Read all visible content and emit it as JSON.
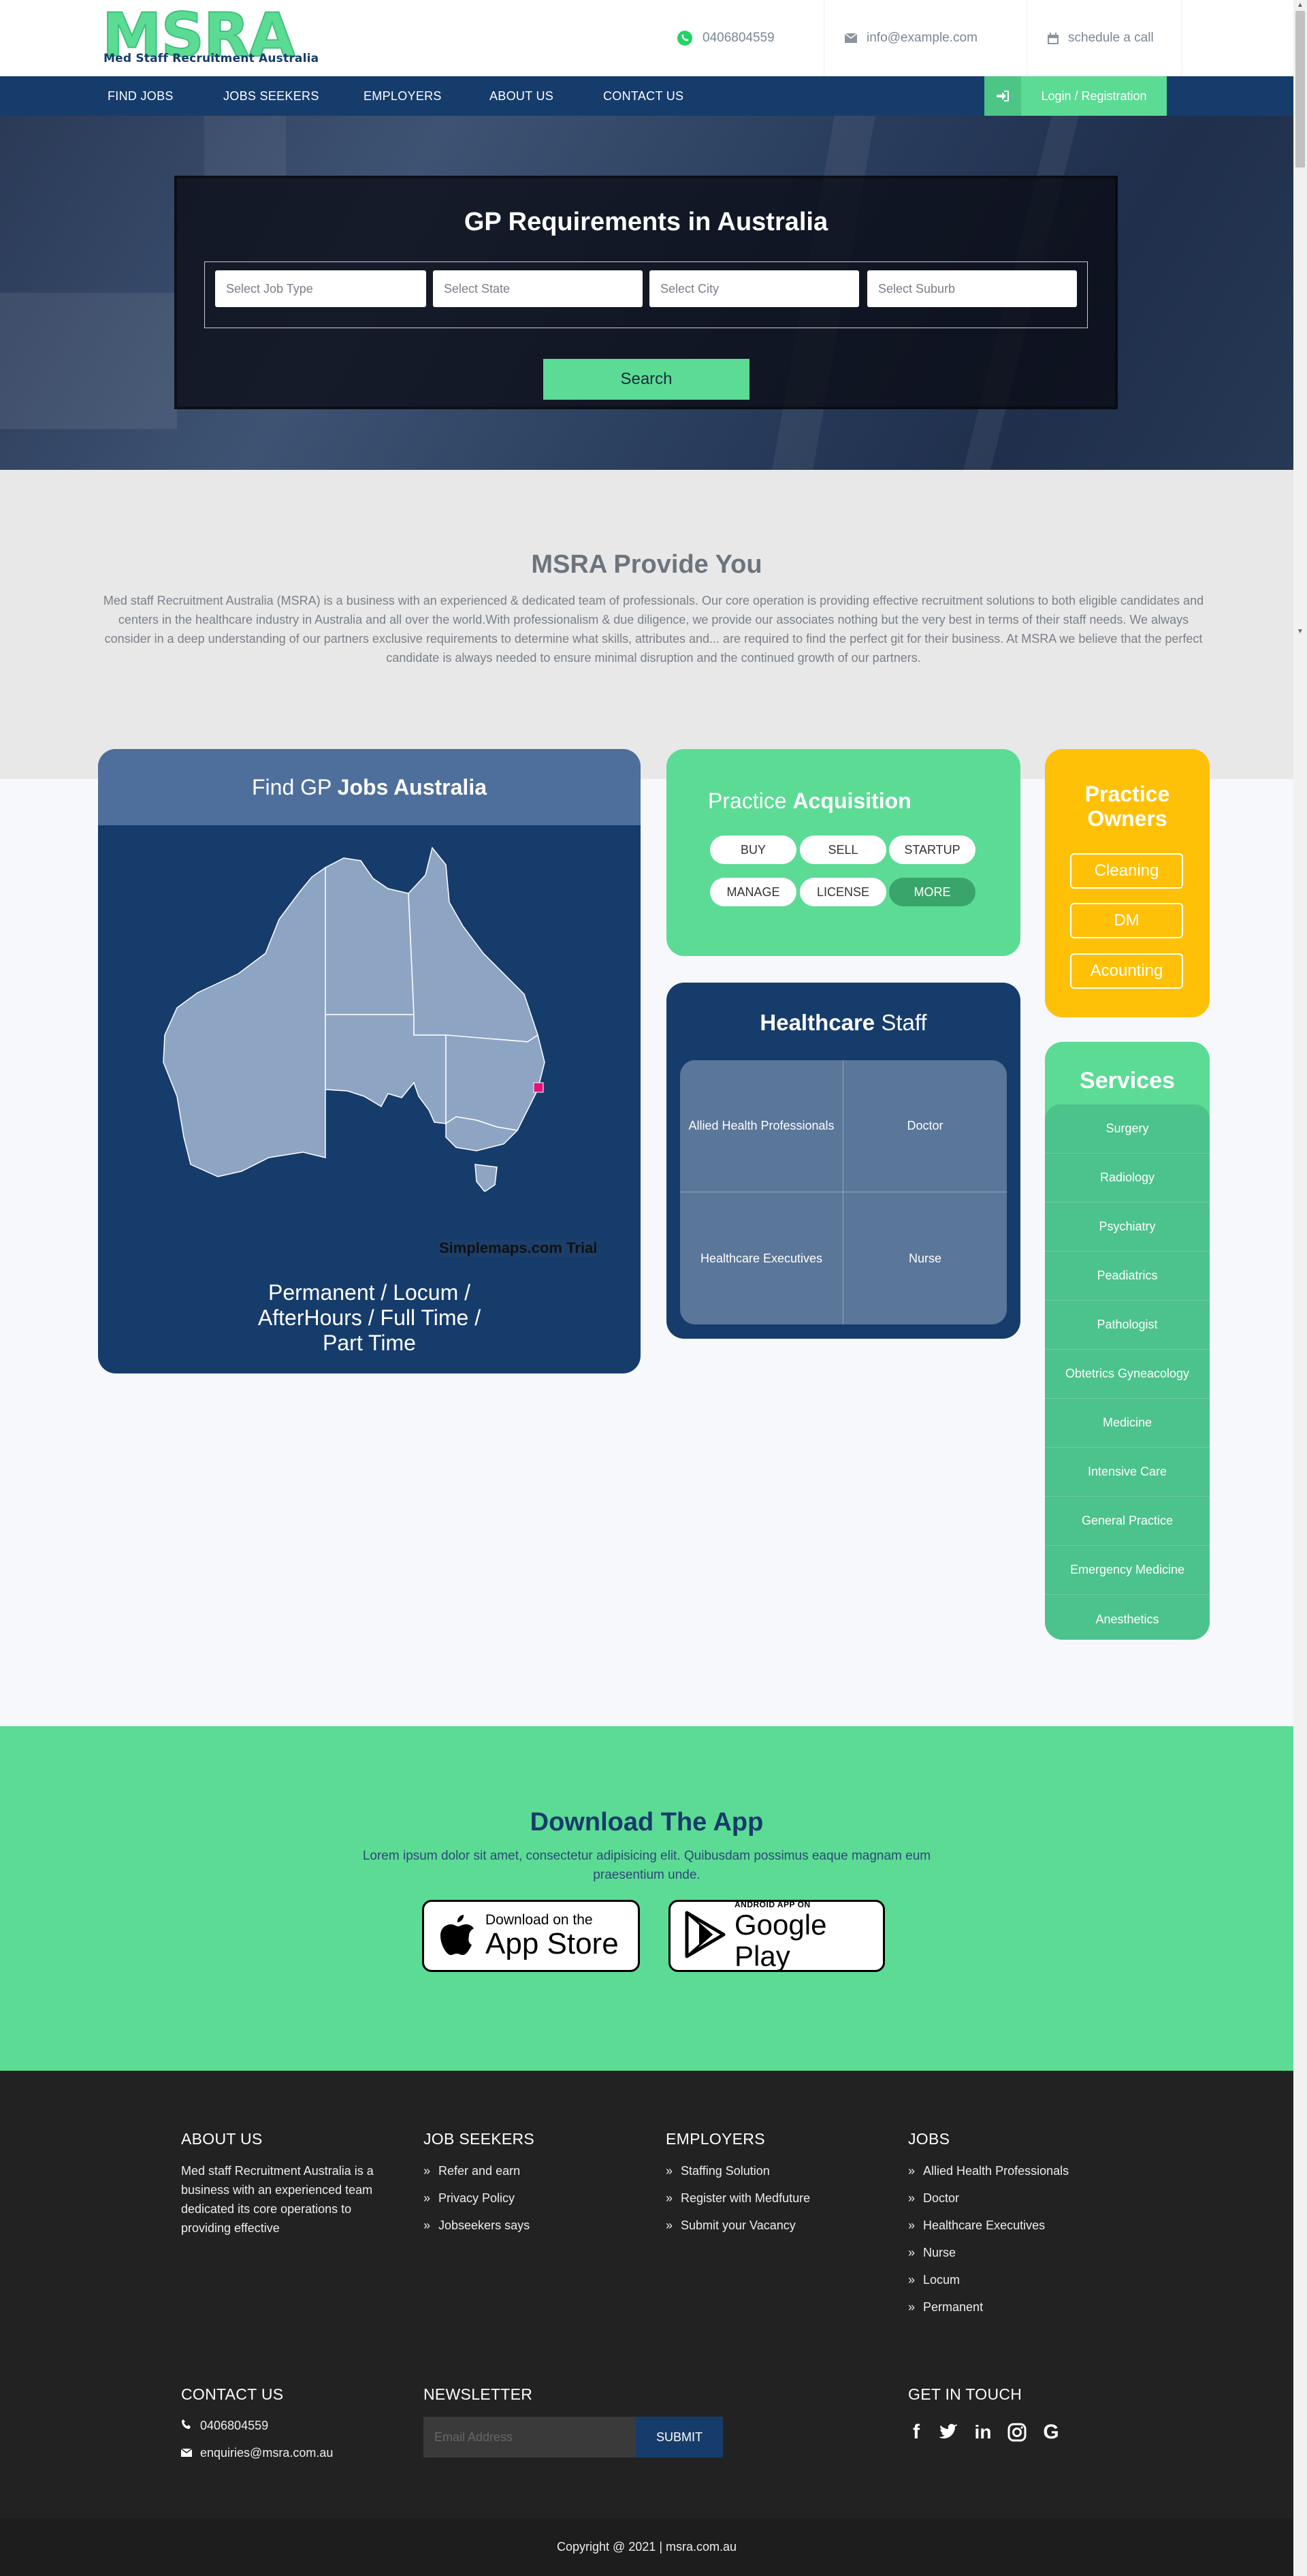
{
  "header": {
    "logo": "MSRA",
    "logo_sub": "Med Staff Recruitment Australia",
    "phone": "0406804559",
    "email": "info@example.com",
    "schedule": "schedule a call"
  },
  "nav": {
    "items": [
      "FIND JOBS",
      "JOBS SEEKERS",
      "EMPLOYERS",
      "ABOUT US",
      "CONTACT US"
    ],
    "login": "Login / Registration"
  },
  "hero": {
    "title": "GP Requirements in Australia",
    "selects": [
      "Select Job Type",
      "Select State",
      "Select City",
      "Select Suburb"
    ],
    "search": "Search"
  },
  "provide": {
    "title": "MSRA Provide You",
    "text": "Med staff Recruitment Australia (MSRA) is a business with an experienced & dedicated team of professionals. Our core operation is providing effective recruitment solutions to both eligible candidates and centers in the healthcare industry in Australia and all over the world.With professionalism & due diligence, we provide our associates nothing but the very best in terms of their staff needs. We always consider in a deep understanding of our partners exclusive requirements to determine what skills, attributes and... are required to find the perfect git for their business. At MSRA we believe that the perfect candidate is always needed to ensure minimal disruption and the continued growth of our partners."
  },
  "gp": {
    "title_a": "Find GP ",
    "title_b": "Jobs Australia",
    "map_trial": "Simplemaps.com Trial",
    "types": "Permanent / Locum / AfterHours / Full Time / Part Time"
  },
  "acquisition": {
    "title_a": "Practice ",
    "title_b": "Acquisition",
    "pills": [
      "BUY",
      "SELL",
      "STARTUP",
      "MANAGE",
      "LICENSE",
      "MORE"
    ]
  },
  "healthcare": {
    "title_a": "Healthcare",
    "title_b": " Staff",
    "cells": [
      "Allied Health Professionals",
      "Doctor",
      "Healthcare Executives",
      "Nurse"
    ]
  },
  "owners": {
    "title": "Practice Owners",
    "buttons": [
      "Cleaning",
      "DM",
      "Acounting"
    ]
  },
  "services": {
    "title": "Services",
    "items": [
      "Surgery",
      "Radiology",
      "Psychiatry",
      "Peadiatrics",
      "Pathologist",
      "Obtetrics Gyneacology",
      "Medicine",
      "Intensive Care",
      "General Practice",
      "Emergency Medicine",
      "Anesthetics"
    ]
  },
  "app": {
    "title": "Download The App",
    "text": "Lorem ipsum dolor sit amet, consectetur adipisicing elit. Quibusdam possimus eaque magnam eum praesentium unde.",
    "appstore_small": "Download on the",
    "appstore_big": "App Store",
    "gplay_small": "ANDROID APP ON",
    "gplay_big": "Google Play"
  },
  "footer": {
    "about_h": "ABOUT US",
    "about_text": "Med staff Recruitment Australia is a business with an experienced team dedicated its core operations to providing effective",
    "seekers_h": "JOB SEEKERS",
    "seekers": [
      "Refer and earn",
      "Privacy Policy",
      "Jobseekers says"
    ],
    "employers_h": "EMPLOYERS",
    "employers": [
      "Staffing Solution",
      "Register with Medfuture",
      "Submit your Vacancy"
    ],
    "jobs_h": "JOBS",
    "jobs": [
      "Allied Health Professionals",
      "Doctor",
      "Healthcare Executives",
      "Nurse",
      "Locum",
      "Permanent"
    ],
    "contact_h": "CONTACT US",
    "phone": "0406804559",
    "email": "enquiries@msra.com.au",
    "newsletter_h": "NEWSLETTER",
    "newsletter_placeholder": "Email Address",
    "submit": "SUBMIT",
    "touch_h": "GET IN TOUCH",
    "copyright": "Copyright @ 2021 | msra.com.au"
  },
  "colors": {
    "green": "#5cdb95",
    "navy": "#163c6b",
    "yellow": "#ffc107",
    "dark": "#222222"
  },
  "icons": [
    "whatsapp-icon",
    "envelope-icon",
    "calendar-icon",
    "sign-in-icon",
    "apple-icon",
    "play-icon",
    "phone-icon",
    "chevron-double-icon",
    "facebook-icon",
    "twitter-icon",
    "linkedin-icon",
    "instagram-icon",
    "google-icon"
  ]
}
